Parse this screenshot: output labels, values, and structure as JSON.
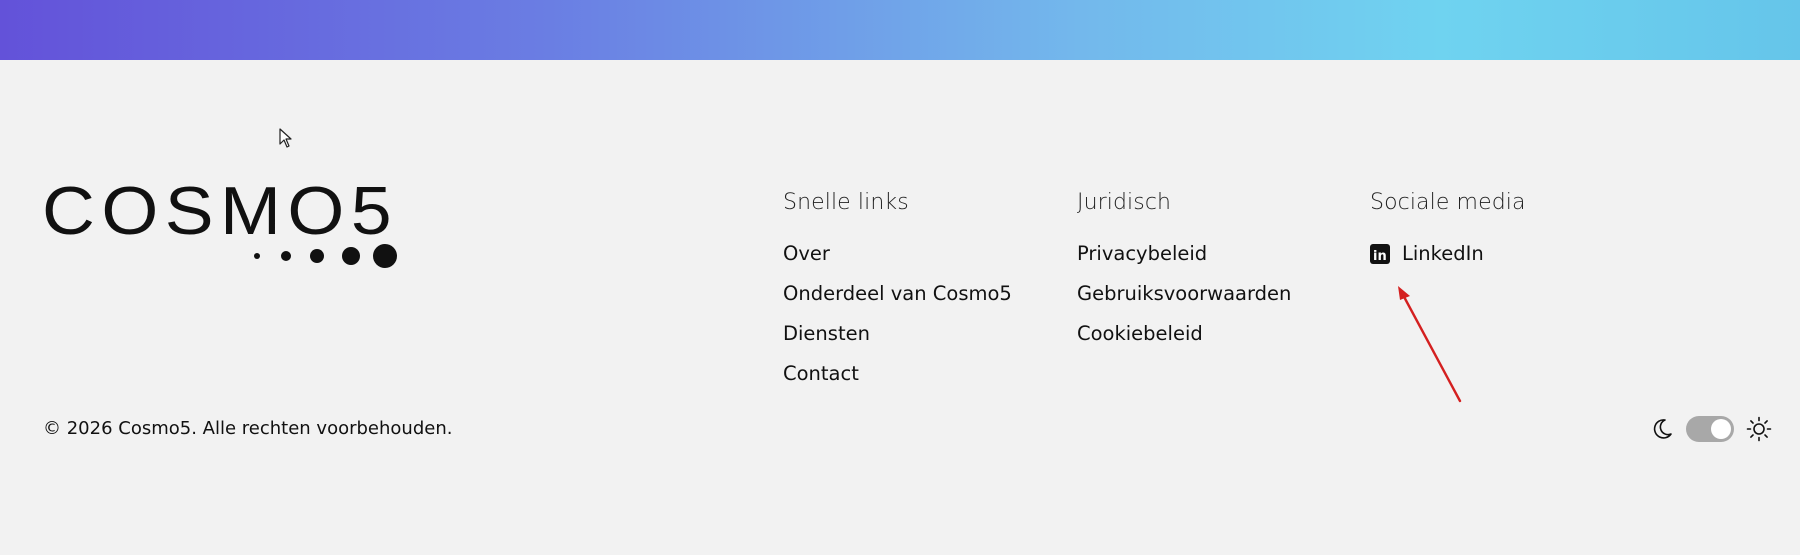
{
  "brand": {
    "logo_text": "COSMO5"
  },
  "footer": {
    "columns": [
      {
        "heading": "Snelle links",
        "links": [
          "Over",
          "Onderdeel van Cosmo5",
          "Diensten",
          "Contact"
        ]
      },
      {
        "heading": "Juridisch",
        "links": [
          "Privacybeleid",
          "Gebruiksvoorwaarden",
          "Cookiebeleid"
        ]
      },
      {
        "heading": "Sociale media",
        "links": [
          {
            "label": "LinkedIn",
            "icon": "linkedin-icon"
          }
        ]
      }
    ],
    "copyright": "© 2026 Cosmo5. Alle rechten voorbehouden.",
    "theme_toggle": {
      "left_icon": "moon-icon",
      "right_icon": "sun-icon",
      "state": "light"
    }
  },
  "colors": {
    "header_gradient": [
      "#6352d9",
      "#6a7de3",
      "#73b8ec",
      "#6fd3f0",
      "#65c5ea"
    ],
    "background": "#f2f2f2",
    "annotation_arrow": "#d42020",
    "toggle_track": "#a8a8a8"
  }
}
